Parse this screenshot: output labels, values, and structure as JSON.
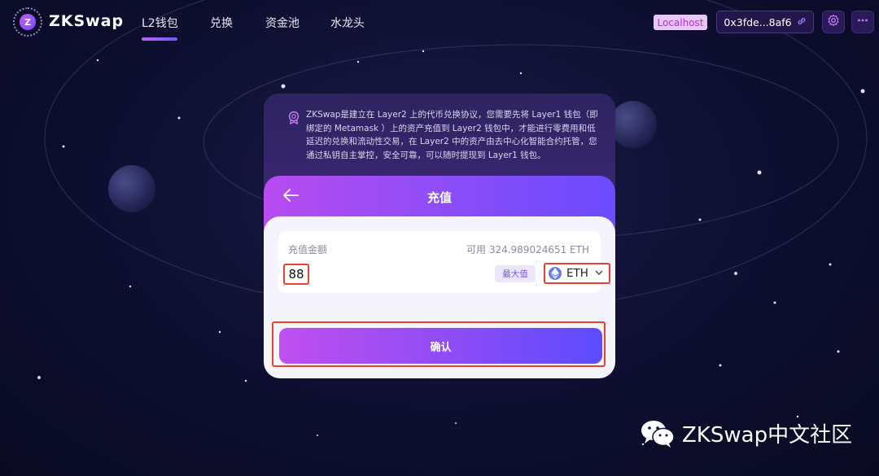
{
  "brand": {
    "name": "ZKSwap",
    "logo_letter": "Z"
  },
  "nav": {
    "items": [
      {
        "label": "L2钱包",
        "active": true
      },
      {
        "label": "兑换",
        "active": false
      },
      {
        "label": "资金池",
        "active": false
      },
      {
        "label": "水龙头",
        "active": false
      }
    ]
  },
  "header": {
    "network_badge": "Localhost",
    "address": "0x3fde...8af6",
    "settings_icon": "gear-icon",
    "more_icon": "more-icon"
  },
  "info": {
    "icon": "badge-icon",
    "text": "ZKSwap是建立在 Layer2 上的代币兑换协议，您需要先将 Layer1 钱包（即绑定的 Metamask ）上的资产充值到 Layer2 钱包中，才能进行零费用和低延迟的兑换和流动性交易，在 Layer2 中的资产由去中心化智能合约托管，您通过私钥自主掌控，安全可靠，可以随时提现到 Layer1 钱包。"
  },
  "deposit": {
    "title": "充值",
    "amount_label": "充值金额",
    "available": "可用 324.989024651 ETH",
    "amount_value": "88",
    "max_label": "最大值",
    "token": "ETH",
    "confirm_label": "确认"
  },
  "watermark": {
    "text": "ZKSwap中文社区",
    "icon": "wechat-icon"
  },
  "colors": {
    "accent_start": "#c04ff0",
    "accent_end": "#5b4cff",
    "highlight_border": "#e8412b",
    "background": "#0e0f30"
  }
}
